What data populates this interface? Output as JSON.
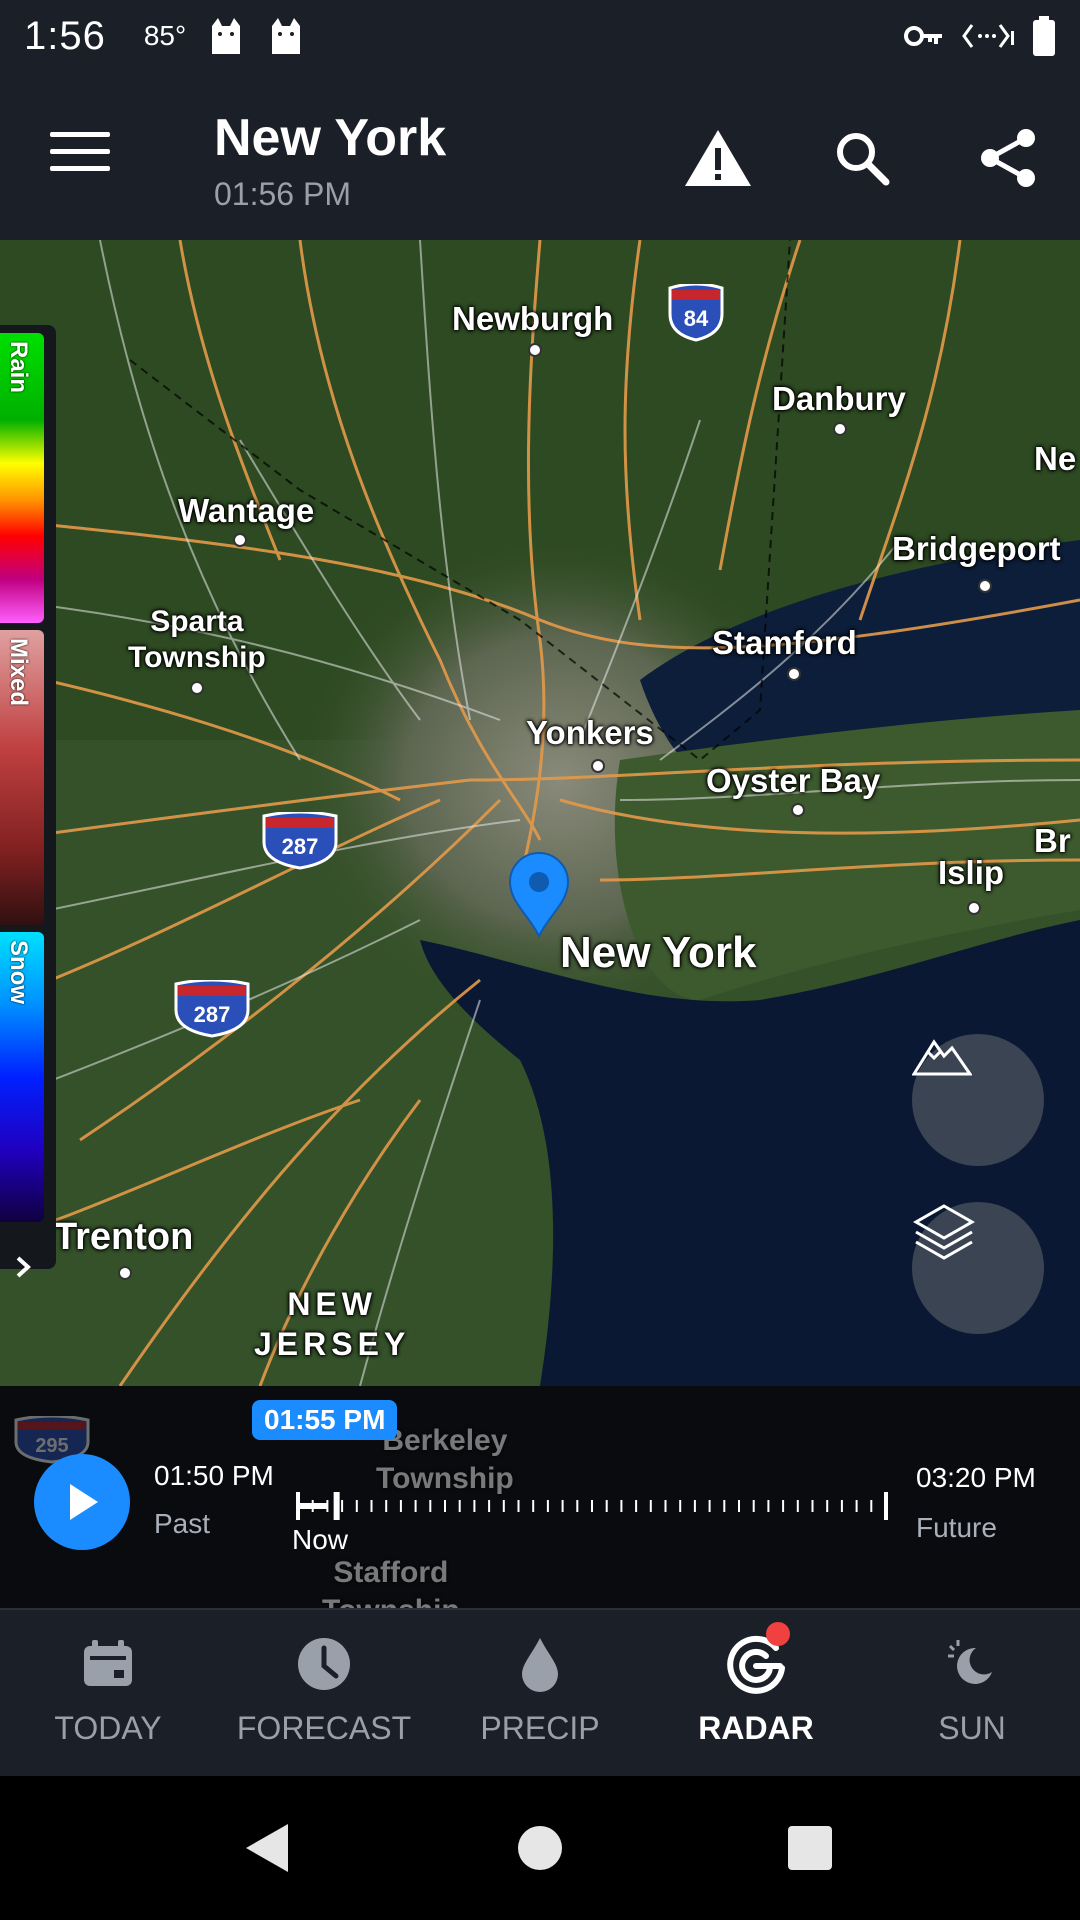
{
  "status_bar": {
    "time": "1:56",
    "temperature": "85°"
  },
  "app_bar": {
    "title": "New York",
    "subtitle": "01:56 PM"
  },
  "map": {
    "cities": [
      {
        "id": "newburgh",
        "label": "Newburgh"
      },
      {
        "id": "danbury",
        "label": "Danbury"
      },
      {
        "id": "ne-partial",
        "label": "Ne"
      },
      {
        "id": "wantage",
        "label": "Wantage"
      },
      {
        "id": "bridgeport",
        "label": "Bridgeport"
      },
      {
        "id": "sparta",
        "label": "Sparta\nTownship"
      },
      {
        "id": "stamford",
        "label": "Stamford"
      },
      {
        "id": "yonkers",
        "label": "Yonkers"
      },
      {
        "id": "oyster-bay",
        "label": "Oyster Bay"
      },
      {
        "id": "br-partial",
        "label": "Br"
      },
      {
        "id": "islip",
        "label": "Islip"
      },
      {
        "id": "new-york",
        "label": "New York"
      },
      {
        "id": "trenton",
        "label": "Trenton"
      },
      {
        "id": "new-jersey",
        "label": "NEW\nJERSEY"
      },
      {
        "id": "berkeley",
        "label": "Berkeley\nTownship"
      },
      {
        "id": "stafford",
        "label": "Stafford\nTownship"
      }
    ],
    "highway_shields": [
      {
        "id": "i84",
        "number": "84"
      },
      {
        "id": "i287-north",
        "number": "287"
      },
      {
        "id": "i287-south",
        "number": "287"
      },
      {
        "id": "i295",
        "number": "295"
      }
    ],
    "legend": {
      "rain": "Rain",
      "mixed": "Mixed",
      "snow": "Snow"
    }
  },
  "timeline": {
    "current_time_badge": "01:55 PM",
    "start_time": "01:50 PM",
    "start_label": "Past",
    "now_label": "Now",
    "end_time": "03:20 PM",
    "end_label": "Future",
    "progress": 0.03
  },
  "bottom_nav": {
    "items": [
      {
        "label": "TODAY",
        "icon": "calendar-icon"
      },
      {
        "label": "FORECAST",
        "icon": "clock-icon"
      },
      {
        "label": "PRECIP",
        "icon": "raindrop-icon"
      },
      {
        "label": "RADAR",
        "icon": "radar-icon",
        "active": true
      },
      {
        "label": "SUN",
        "icon": "moon-sun-icon"
      }
    ]
  },
  "colors": {
    "accent": "#1a8cff",
    "bar_background": "#1b1f28",
    "notification_dot": "#f04040"
  }
}
